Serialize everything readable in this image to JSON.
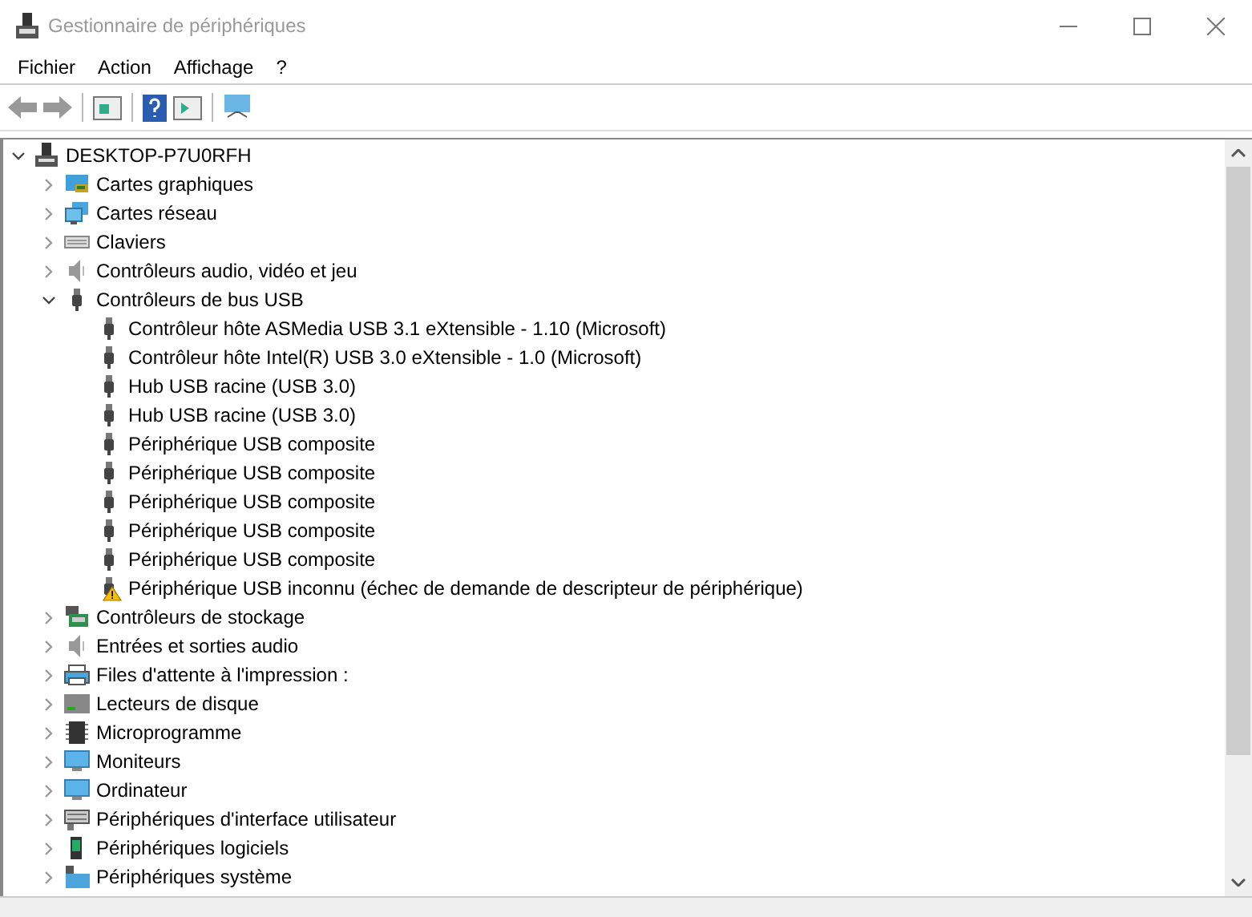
{
  "window": {
    "title": "Gestionnaire de périphériques"
  },
  "menu": [
    "Fichier",
    "Action",
    "Affichage",
    "?"
  ],
  "tree": {
    "label": "DESKTOP-P7U0RFH",
    "expanded": true,
    "children": [
      {
        "label": "Cartes graphiques",
        "expanded": false
      },
      {
        "label": "Cartes réseau",
        "expanded": false
      },
      {
        "label": "Claviers",
        "expanded": false
      },
      {
        "label": "Contrôleurs audio, vidéo et jeu",
        "expanded": false
      },
      {
        "label": "Contrôleurs de bus USB",
        "expanded": true,
        "children": [
          {
            "label": "Contrôleur hôte ASMedia USB 3.1 eXtensible - 1.10 (Microsoft)",
            "warning": false
          },
          {
            "label": "Contrôleur hôte Intel(R) USB 3.0 eXtensible - 1.0 (Microsoft)",
            "warning": false
          },
          {
            "label": "Hub USB racine (USB 3.0)",
            "warning": false
          },
          {
            "label": "Hub USB racine (USB 3.0)",
            "warning": false
          },
          {
            "label": "Périphérique USB composite",
            "warning": false
          },
          {
            "label": "Périphérique USB composite",
            "warning": false
          },
          {
            "label": "Périphérique USB composite",
            "warning": false
          },
          {
            "label": "Périphérique USB composite",
            "warning": false
          },
          {
            "label": "Périphérique USB composite",
            "warning": false
          },
          {
            "label": "Périphérique USB inconnu (échec de demande de descripteur de périphérique)",
            "warning": true
          }
        ]
      },
      {
        "label": "Contrôleurs de stockage",
        "expanded": false
      },
      {
        "label": "Entrées et sorties audio",
        "expanded": false
      },
      {
        "label": "Files d'attente à l'impression :",
        "expanded": false
      },
      {
        "label": "Lecteurs de disque",
        "expanded": false
      },
      {
        "label": "Microprogramme",
        "expanded": false
      },
      {
        "label": "Moniteurs",
        "expanded": false
      },
      {
        "label": "Ordinateur",
        "expanded": false
      },
      {
        "label": "Périphériques d'interface utilisateur",
        "expanded": false
      },
      {
        "label": "Périphériques logiciels",
        "expanded": false
      },
      {
        "label": "Périphériques système",
        "expanded": false
      }
    ]
  }
}
